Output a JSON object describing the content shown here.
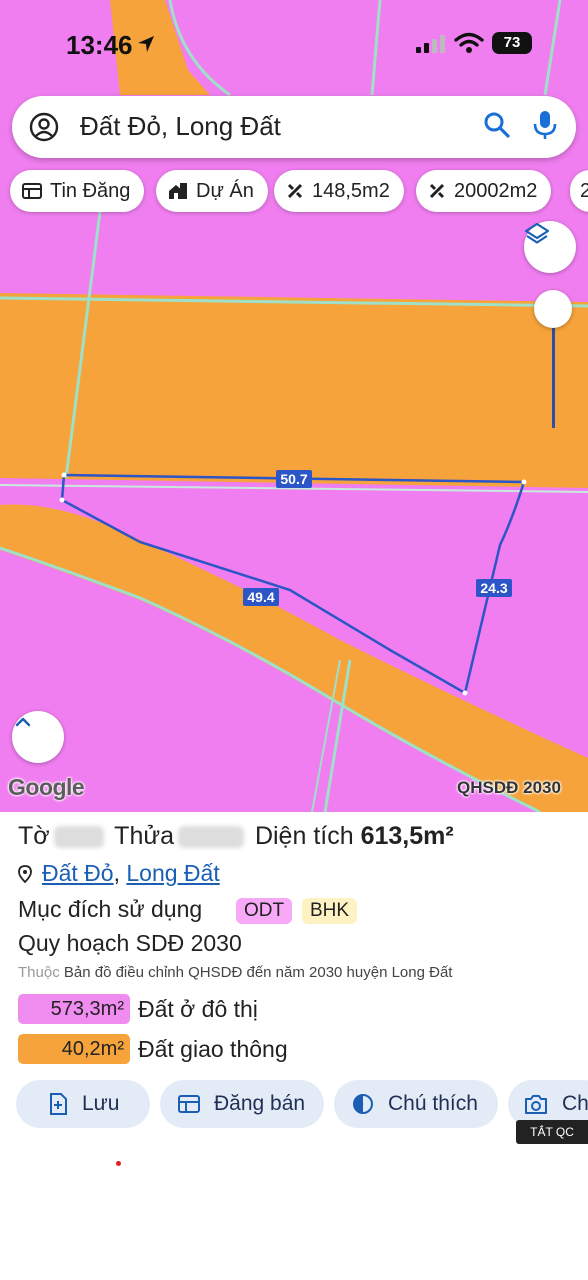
{
  "status_bar": {
    "time": "13:46",
    "battery": "73"
  },
  "search": {
    "query": "Đất Đỏ, Long Đất"
  },
  "chips": [
    {
      "label": "Tin Đăng",
      "icon": "newspaper-icon"
    },
    {
      "label": "Dự Án",
      "icon": "house-icon"
    },
    {
      "label": "148,5m2",
      "icon": "measure-icon"
    },
    {
      "label": "20002m2",
      "icon": "measure-icon"
    }
  ],
  "map": {
    "attribution": "Google",
    "layer_name": "QHSDĐ 2030",
    "measurements": {
      "top": "50.7",
      "left": "49.4",
      "right": "24.3"
    },
    "colors": {
      "residential": "#f07ef0",
      "traffic": "#f5a33a",
      "boundary": "#2c55c7"
    }
  },
  "parcel": {
    "to_label": "Tờ",
    "thua_label": "Thửa",
    "area_label": "Diện tích",
    "area_value": "613,5m²",
    "location": [
      "Đất Đỏ",
      "Long Đất"
    ],
    "purpose_label": "Mục đích sử dụng",
    "purpose_tags": [
      {
        "code": "ODT",
        "color": "#f7a8f7"
      },
      {
        "code": "BHK",
        "color": "#fff2c2"
      }
    ],
    "plan_title": "Quy hoạch SDĐ 2030",
    "plan_source_prefix": "Thuộc",
    "plan_source": "Bản đồ điều chỉnh QHSDĐ đến năm 2030 huyện Long Đất",
    "breakdown": [
      {
        "area": "573,3m²",
        "label": "Đất ở đô thị",
        "color": "#f08cf0"
      },
      {
        "area": "40,2m²",
        "label": "Đất giao thông",
        "color": "#f5a33a"
      }
    ]
  },
  "actions": [
    {
      "label": "Lưu",
      "icon": "save-icon"
    },
    {
      "label": "Đăng bán",
      "icon": "listing-icon"
    },
    {
      "label": "Chú thích",
      "icon": "legend-icon"
    },
    {
      "label": "Ch",
      "icon": "camera-icon"
    }
  ],
  "ad_tag": "TẮT QC"
}
